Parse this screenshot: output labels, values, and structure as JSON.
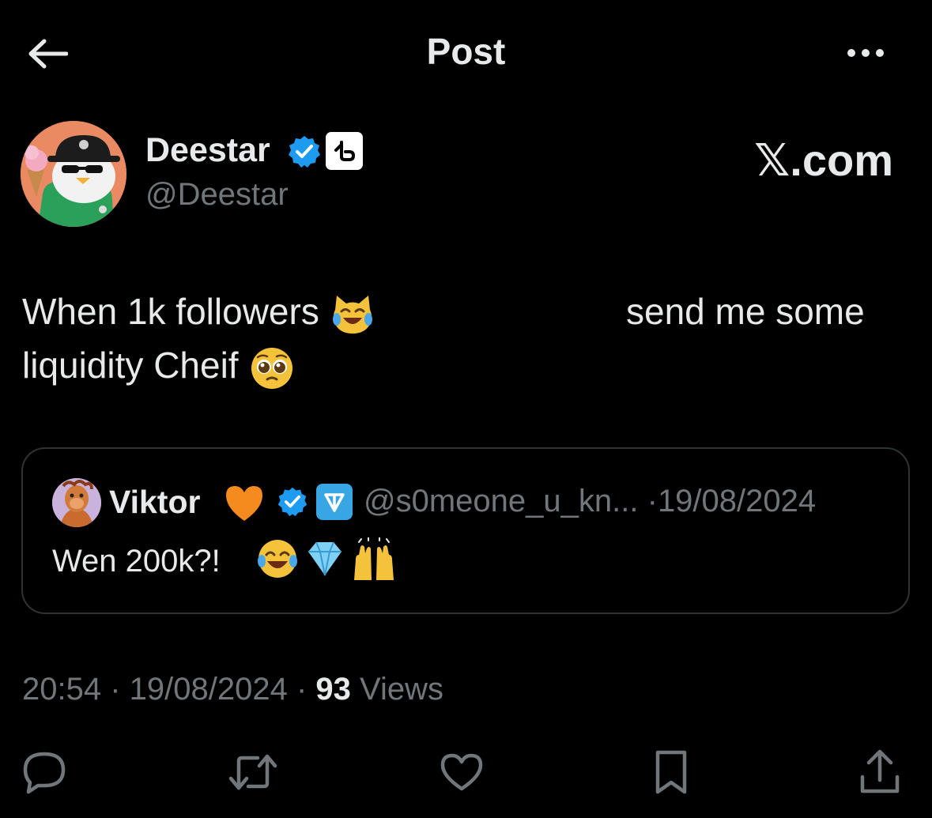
{
  "header": {
    "title": "Post",
    "back_icon": "arrow-left-icon",
    "more_icon": "more-horizontal-icon"
  },
  "author": {
    "name": "Deestar",
    "handle": "@Deestar",
    "verified": true,
    "affiliate_badge_icon": "affiliate-badge-icon"
  },
  "watermark": "𝕏.com",
  "tweet": {
    "line1_left": "When 1k followers",
    "line1_emoji": "cat-tears-of-joy-emoji",
    "line1_right": "send me some",
    "line2": "liquidity Cheif",
    "line2_emoji": "pleading-face-emoji"
  },
  "quote": {
    "name": "Viktor",
    "handle": "@s0meone_u_kn...",
    "separator": "·",
    "date": "19/08/2024",
    "text": "Wen 200k?!",
    "emojis": [
      "tears-of-joy-emoji",
      "gem-emoji",
      "raising-hands-emoji"
    ]
  },
  "meta": {
    "time": "20:54",
    "sep1": " · ",
    "date": "19/08/2024",
    "sep2": " · ",
    "views_count": "93",
    "views_label": " Views"
  },
  "actions": {
    "reply_icon": "reply-icon",
    "repost_icon": "repost-icon",
    "like_icon": "heart-icon",
    "bookmark_icon": "bookmark-icon",
    "share_icon": "share-icon"
  },
  "colors": {
    "background": "#000000",
    "text_primary": "#e7e9ea",
    "text_secondary": "#71767b",
    "verified_blue": "#1d9bf0",
    "border": "#2f3336"
  }
}
